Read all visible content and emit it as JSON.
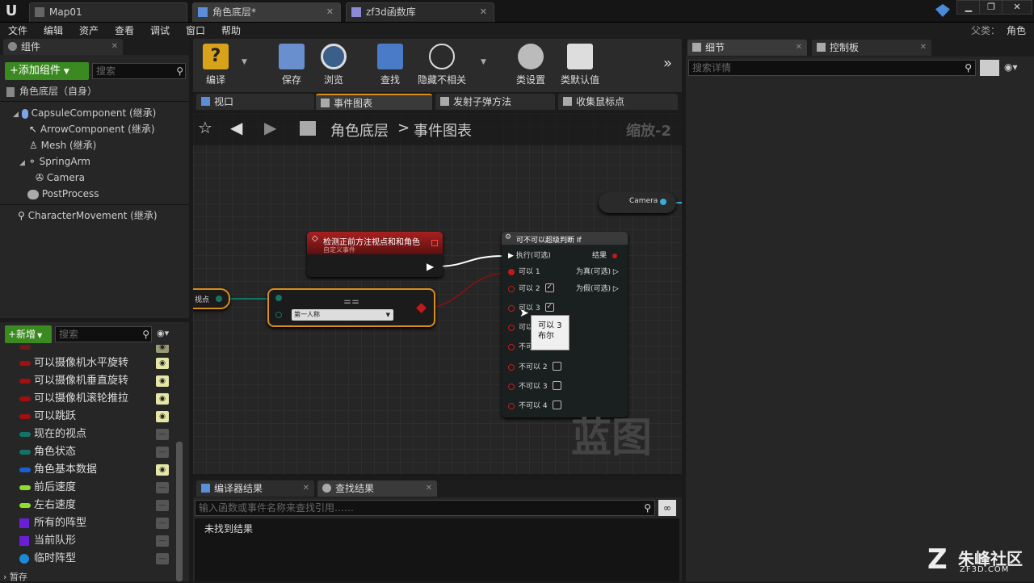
{
  "titlebar": {
    "tabs": [
      "Map01",
      "角色底层*",
      "zf3d函数库"
    ],
    "parent_label": "父类：",
    "parent_value": "角色"
  },
  "menu": [
    "文件",
    "编辑",
    "资产",
    "查看",
    "调试",
    "窗口",
    "帮助"
  ],
  "components": {
    "tab": "组件",
    "add_button": "+添加组件",
    "search_placeholder": "搜索",
    "root": "角色底层（自身）",
    "items": [
      "CapsuleComponent (继承)",
      "ArrowComponent (继承)",
      "Mesh (继承)",
      "SpringArm",
      "Camera",
      "PostProcess",
      "CharacterMovement (继承)"
    ]
  },
  "mybp": {
    "add_button": "+新增",
    "search_placeholder": "搜索",
    "variables": [
      {
        "label": "可以摄像机水平旋转",
        "color": "#a01010",
        "eye": true
      },
      {
        "label": "可以摄像机垂直旋转",
        "color": "#a01010",
        "eye": true
      },
      {
        "label": "可以摄像机滚轮推拉",
        "color": "#a01010",
        "eye": true
      },
      {
        "label": "可以跳跃",
        "color": "#a01010",
        "eye": true
      },
      {
        "label": "现在的视点",
        "color": "#137466",
        "eye": false
      },
      {
        "label": "角色状态",
        "color": "#137466",
        "eye": false
      },
      {
        "label": "角色基本数据",
        "color": "#1a5fd6",
        "eye": true
      },
      {
        "label": "前后速度",
        "color": "#8fdc2c",
        "eye": false
      },
      {
        "label": "左右速度",
        "color": "#8fdc2c",
        "eye": false
      },
      {
        "label": "所有的阵型",
        "color": "#6a1fd6",
        "eye": false
      },
      {
        "label": "当前队形",
        "color": "#6a1fd6",
        "eye": false
      },
      {
        "label": "临时阵型",
        "color": "#1a8ad6",
        "eye": false
      }
    ],
    "footer": "暂存"
  },
  "toolbar": [
    "编译",
    "保存",
    "浏览",
    "查找",
    "隐藏不相关",
    "类设置",
    "类默认值"
  ],
  "graph_tabs": [
    "视口",
    "事件图表",
    "发射子弹方法",
    "收集鼠标点"
  ],
  "breadcrumb": {
    "root": "角色底层",
    "sep": ">",
    "current": "事件图表",
    "zoom": "缩放-2"
  },
  "nodes": {
    "camera": "Camera",
    "event_title": "检测正前方注视点和和角色",
    "event_subtitle": "自定义事件",
    "var_label": "视点",
    "enum_value": "第一人称",
    "equal_symbol": "==",
    "branch_title": "可不可以超级判断 If",
    "exec_in": "执行(可选)",
    "result": "结果",
    "true_out": "为真(可选)",
    "false_out": "为假(可选)",
    "inputs": [
      "可以 1",
      "可以 2",
      "可以 3",
      "可以 4",
      "不可以 1",
      "不可以 2",
      "不可以 3",
      "不可以 4"
    ],
    "tooltip_line1": "可以 3",
    "tooltip_line2": "布尔",
    "watermark": "蓝图"
  },
  "bottom": {
    "tabs": [
      "编译器结果",
      "查找结果"
    ],
    "search_placeholder": "输入函数或事件名称来查找引用……",
    "result_text": "未找到结果"
  },
  "details": {
    "tabs": [
      "细节",
      "控制板"
    ],
    "search_placeholder": "搜索详情"
  },
  "watermark_brand": {
    "main": "朱峰社区",
    "sub": "ZF3D.COM"
  }
}
